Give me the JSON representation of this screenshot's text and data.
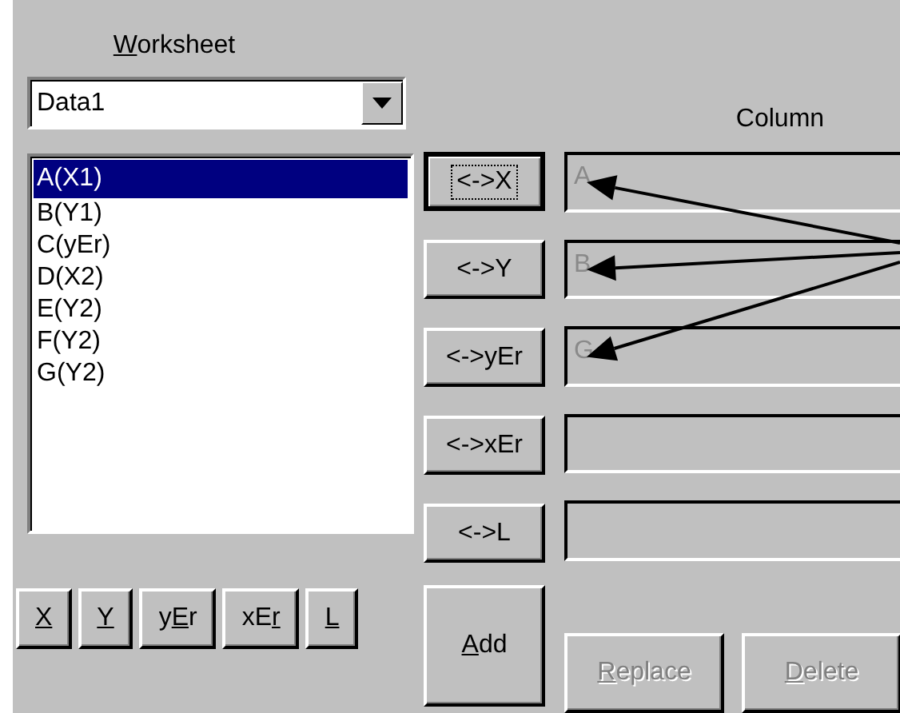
{
  "worksheet": {
    "label": {
      "key": "W",
      "post": "orksheet"
    },
    "dropdown": {
      "value": "Data1"
    },
    "columns": [
      {
        "label": "A(X1)",
        "selected": true
      },
      {
        "label": "B(Y1)",
        "selected": false
      },
      {
        "label": "C(yEr)",
        "selected": false
      },
      {
        "label": "D(X2)",
        "selected": false
      },
      {
        "label": "E(Y2)",
        "selected": false
      },
      {
        "label": "F(Y2)",
        "selected": false
      },
      {
        "label": "G(Y2)",
        "selected": false
      }
    ],
    "buttons": [
      {
        "label": {
          "key": "X"
        }
      },
      {
        "label": {
          "key": "Y"
        }
      },
      {
        "label": {
          "pre": "y",
          "key": "E",
          "post": "r"
        }
      },
      {
        "label": {
          "pre": "xE",
          "key": "r"
        }
      },
      {
        "label": {
          "key": "L"
        }
      }
    ]
  },
  "column_header": "Column",
  "assignments": [
    {
      "button": "<->X",
      "focused": true,
      "value": "A",
      "disabled": true,
      "arrow": true
    },
    {
      "button": "<->Y",
      "focused": false,
      "value": "B",
      "disabled": true,
      "arrow": true
    },
    {
      "button": "<->yEr",
      "focused": false,
      "value": "G",
      "disabled": true,
      "arrow": true
    },
    {
      "button": "<->xEr",
      "focused": false,
      "disabled": true,
      "arrow": false
    },
    {
      "button": "<->L",
      "focused": false,
      "disabled": true,
      "arrow": false
    }
  ],
  "actions": [
    {
      "kind": "add",
      "label": {
        "key": "A",
        "post": "dd"
      },
      "disabled": false
    },
    {
      "kind": "replace",
      "label": {
        "key": "R",
        "post": "eplace"
      },
      "disabled": true
    },
    {
      "kind": "delete",
      "label": {
        "key": "D",
        "post": "elete"
      },
      "disabled": true
    }
  ]
}
